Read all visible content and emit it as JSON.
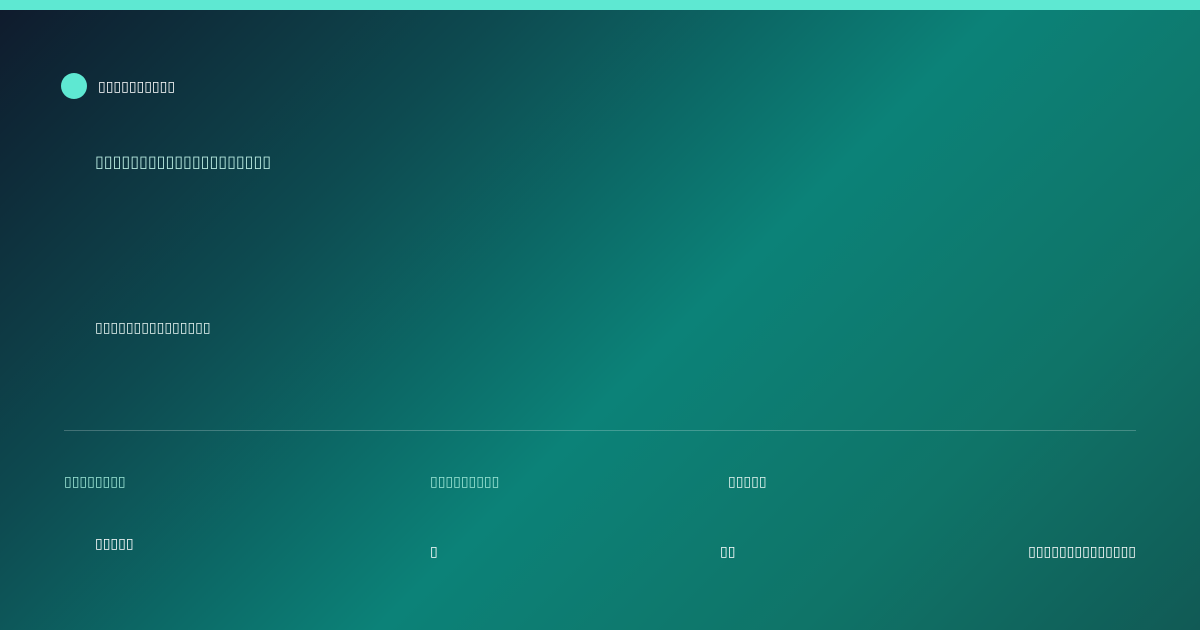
{
  "brand": {
    "name": "▯▯▯▯▯▯▯▯▯▯"
  },
  "hero": {
    "headline": "▯▯▯▯▯▯▯▯▯▯▯▯▯▯▯▯▯▯▯▯",
    "subtitle": "▯▯▯▯▯▯▯▯▯▯▯▯▯▯▯"
  },
  "meta": {
    "labels": [
      "▯▯▯▯▯▯▯▯",
      "▯▯▯▯▯▯▯▯▯",
      "▯▯▯▯▯"
    ],
    "values": [
      "▯▯▯▯▯",
      "▯",
      "▯▯",
      "▯▯▯▯▯▯▯▯▯▯▯▯▯▯"
    ]
  },
  "colors": {
    "accent": "#5ee8d2",
    "gradient_start": "#0f1a2c",
    "gradient_mid": "#0c8278",
    "gradient_end": "#115a55"
  },
  "icons": [
    "brand-dot-icon"
  ]
}
